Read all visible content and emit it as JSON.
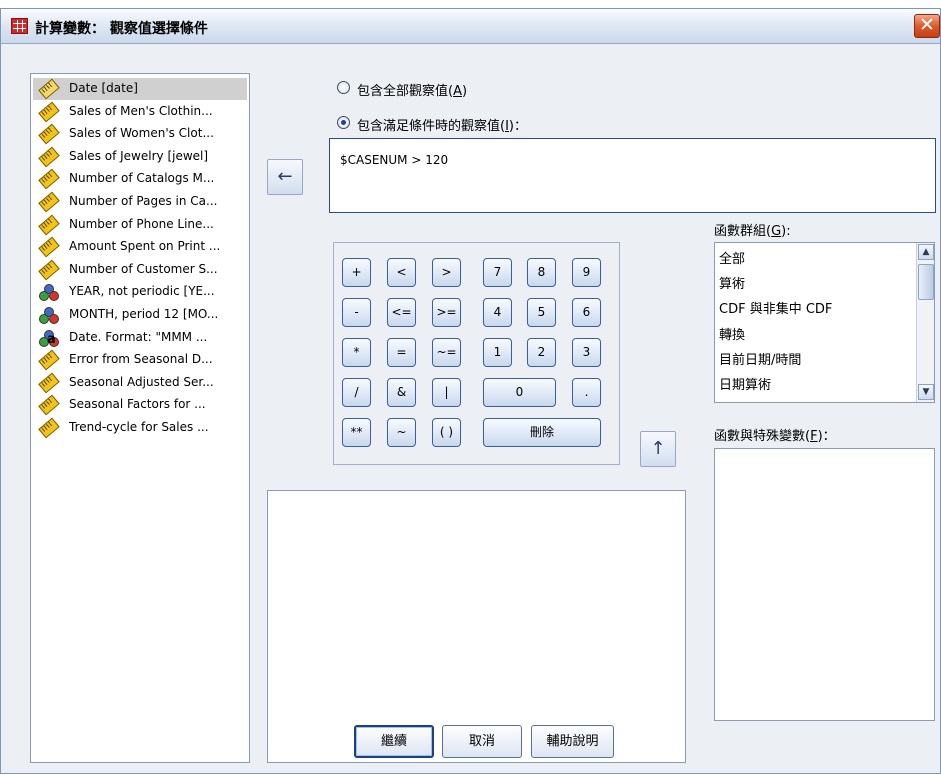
{
  "window": {
    "title": "計算變數： 觀察值選擇條件",
    "close_glyph": "✕"
  },
  "variables": [
    {
      "label": "Date [date]",
      "icon": "date-icon",
      "selected": true
    },
    {
      "label": "Sales of Men's Clothin...",
      "icon": "scale-ruler-icon"
    },
    {
      "label": "Sales of Women's Clot...",
      "icon": "scale-ruler-icon"
    },
    {
      "label": "Sales of Jewelry [jewel]",
      "icon": "scale-ruler-icon"
    },
    {
      "label": "Number of Catalogs M...",
      "icon": "scale-ruler-icon"
    },
    {
      "label": "Number of Pages in Ca...",
      "icon": "scale-ruler-icon"
    },
    {
      "label": "Number of Phone Line...",
      "icon": "scale-ruler-icon"
    },
    {
      "label": "Amount Spent on Print ...",
      "icon": "scale-ruler-icon"
    },
    {
      "label": "Number of Customer S...",
      "icon": "scale-ruler-icon"
    },
    {
      "label": "YEAR, not periodic [YE...",
      "icon": "nominal-icon"
    },
    {
      "label": "MONTH, period 12 [MO...",
      "icon": "nominal-icon"
    },
    {
      "label": "Date.  Format:  \"MMM ...",
      "icon": "nominal-string-icon"
    },
    {
      "label": "Error from Seasonal D...",
      "icon": "scale-ruler-icon"
    },
    {
      "label": "Seasonal Adjusted Ser...",
      "icon": "scale-ruler-icon"
    },
    {
      "label": "Seasonal Factors for ...",
      "icon": "scale-ruler-icon"
    },
    {
      "label": "Trend-cycle for Sales ...",
      "icon": "scale-ruler-icon"
    }
  ],
  "options": {
    "all_cases": {
      "text": "包含全部觀察值(",
      "key": "A",
      "suffix": ")",
      "checked": false
    },
    "condition": {
      "text": "包含滿足條件時的觀察值(",
      "key": "I",
      "suffix": ")：",
      "checked": true
    }
  },
  "expression": "$CASENUM > 120",
  "keypad": {
    "keys": [
      "+",
      "<",
      ">",
      "7",
      "8",
      "9",
      "-",
      "<=",
      ">=",
      "4",
      "5",
      "6",
      "*",
      "=",
      "~=",
      "1",
      "2",
      "3",
      "/",
      "&",
      "|",
      "0",
      ".",
      "**",
      "~",
      "( )",
      "刪除"
    ]
  },
  "function_group": {
    "label": "函數群組(",
    "key": "G",
    "suffix": "):",
    "items": [
      "全部",
      "算術",
      "CDF 與非集中 CDF",
      "轉換",
      "目前日期/時間",
      "日期算術"
    ]
  },
  "functions_label": {
    "text": "函數與特殊變數(",
    "key": "F",
    "suffix": ")："
  },
  "buttons": {
    "continue": "繼續",
    "cancel": "取消",
    "help": "輔助說明"
  },
  "icons": {
    "move_left": "←",
    "move_up": "↑",
    "scroll_up": "▲",
    "scroll_down": "▼"
  },
  "colors": {
    "title_bar": "#dbe5f2",
    "close_button": "#dc5a2d",
    "selection": "#d0d0d0"
  }
}
